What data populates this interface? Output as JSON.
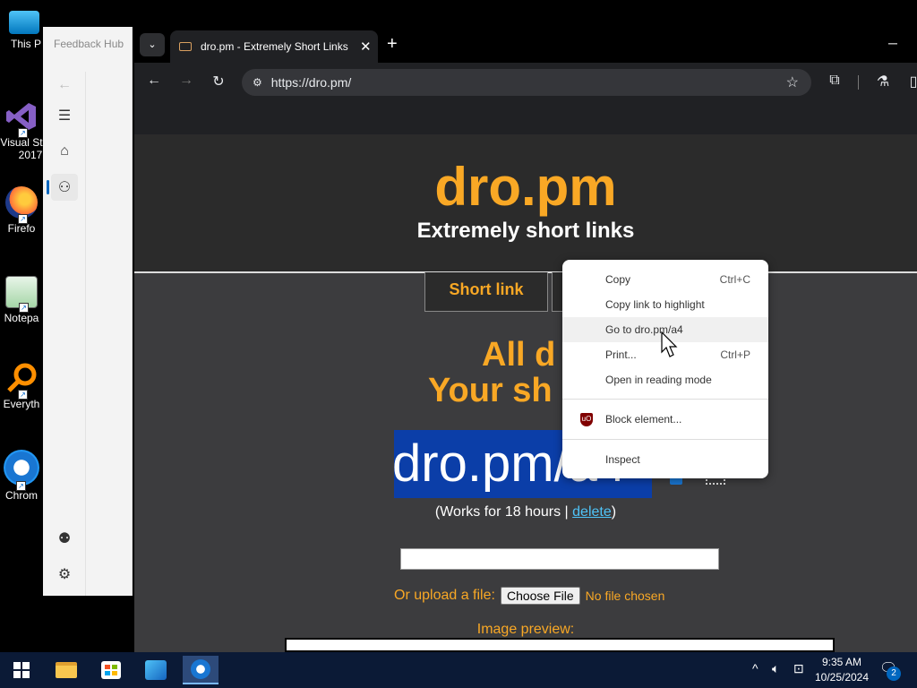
{
  "desktop": {
    "icons": [
      {
        "label": "This P"
      },
      {
        "label": "Visual St"
      },
      {
        "label": "2017"
      },
      {
        "label": "Firefo"
      },
      {
        "label": "Notepa"
      },
      {
        "label": "Everyth"
      },
      {
        "label": "Chrom"
      }
    ]
  },
  "feedback_hub": {
    "title": "Feedback Hub"
  },
  "browser": {
    "tab_title": "dro.pm - Extremely Short Links",
    "tab_close": "✕",
    "new_tab": "+",
    "minimize": "─",
    "url": "https://dro.pm/"
  },
  "site": {
    "logo": "dro.pm",
    "tagline": "Extremely short links",
    "tab_short_link": "Short link",
    "heading_line1": "All d",
    "heading_line2": "Your sh",
    "short_url": "dro.pm/a4",
    "works_prefix": "(Works for 18 hours | ",
    "delete_link": "delete",
    "works_suffix": ")",
    "upload_label": "Or upload a file:",
    "choose_file": "Choose File",
    "no_file": "No file chosen",
    "image_preview": "Image preview:"
  },
  "context_menu": {
    "items": [
      {
        "label": "Copy",
        "shortcut": "Ctrl+C"
      },
      {
        "label": "Copy link to highlight",
        "shortcut": ""
      },
      {
        "label": "Go to dro.pm/a4",
        "shortcut": ""
      },
      {
        "label": "Print...",
        "shortcut": "Ctrl+P"
      },
      {
        "label": "Open in reading mode",
        "shortcut": ""
      },
      {
        "label": "Block element...",
        "shortcut": ""
      },
      {
        "label": "Inspect",
        "shortcut": ""
      }
    ]
  },
  "taskbar": {
    "time": "9:35 AM",
    "date": "10/25/2024",
    "notification_count": "2"
  },
  "colors": {
    "accent_orange": "#f9a825",
    "selection_blue": "#0b3ea8",
    "link_blue": "#4fc3f7"
  }
}
